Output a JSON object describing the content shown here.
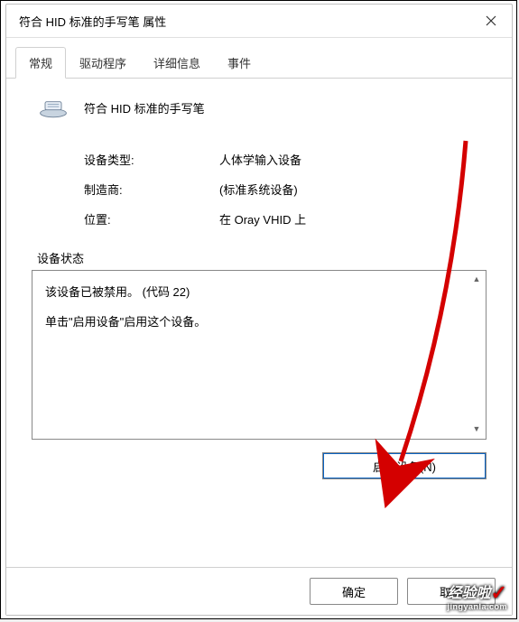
{
  "window": {
    "title": "符合 HID 标准的手写笔 属性"
  },
  "tabs": {
    "general": "常规",
    "driver": "驱动程序",
    "details": "详细信息",
    "events": "事件"
  },
  "device": {
    "name": "符合 HID 标准的手写笔"
  },
  "props": {
    "type_label": "设备类型:",
    "type_value": "人体学输入设备",
    "mfg_label": "制造商:",
    "mfg_value": "(标准系统设备)",
    "loc_label": "位置:",
    "loc_value": "在 Oray VHID 上"
  },
  "status": {
    "group_label": "设备状态",
    "line1": "该设备已被禁用。 (代码 22)",
    "line2": "单击\"启用设备\"启用这个设备。"
  },
  "buttons": {
    "enable": "启用设备(N)",
    "ok": "确定",
    "cancel": "取消"
  },
  "watermark": {
    "brand": "经验啦",
    "url": "jingyanla.com"
  }
}
